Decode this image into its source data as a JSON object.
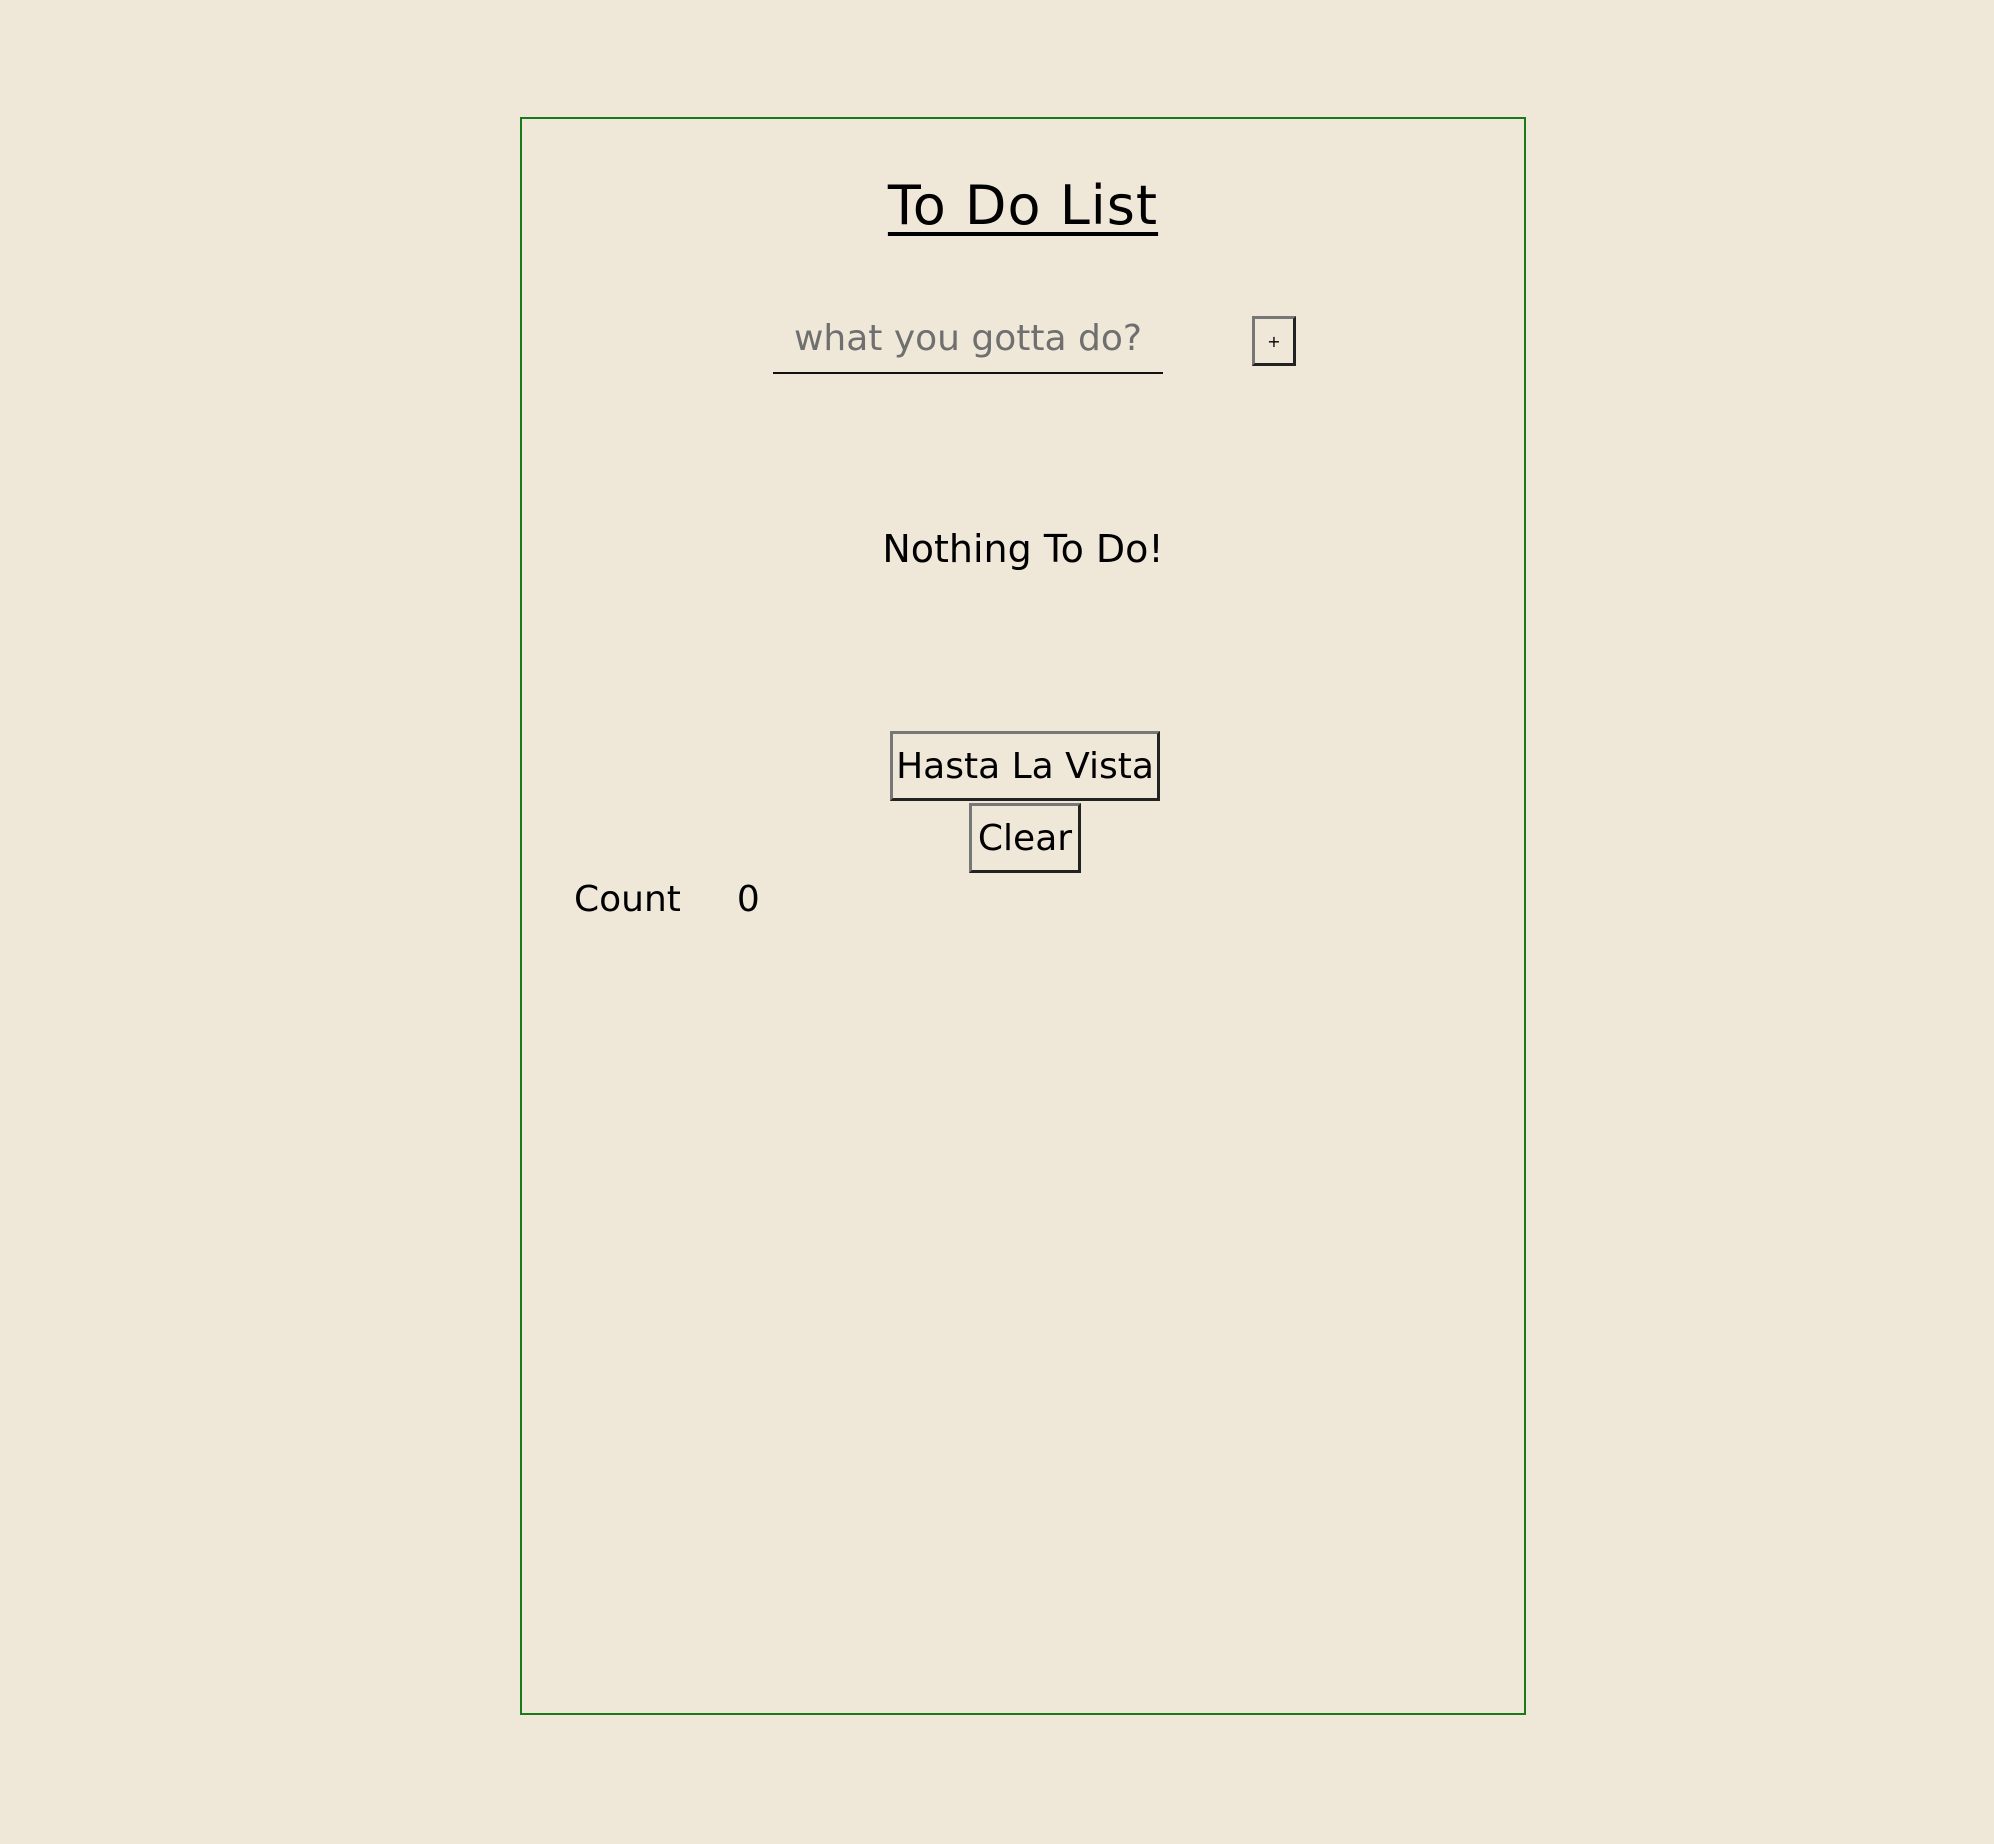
{
  "app": {
    "title": "To Do List",
    "input_placeholder": "what you gotta do?",
    "input_value": "",
    "add_button_label": "+",
    "empty_message": "Nothing To Do!",
    "hasta_button_label": "Hasta La Vista",
    "clear_button_label": "Clear",
    "count_label": "Count",
    "count_value": "0"
  },
  "colors": {
    "background": "#efe8d9",
    "card_border": "#1a7a1a",
    "text": "#000000",
    "placeholder": "#6f6f6f"
  }
}
